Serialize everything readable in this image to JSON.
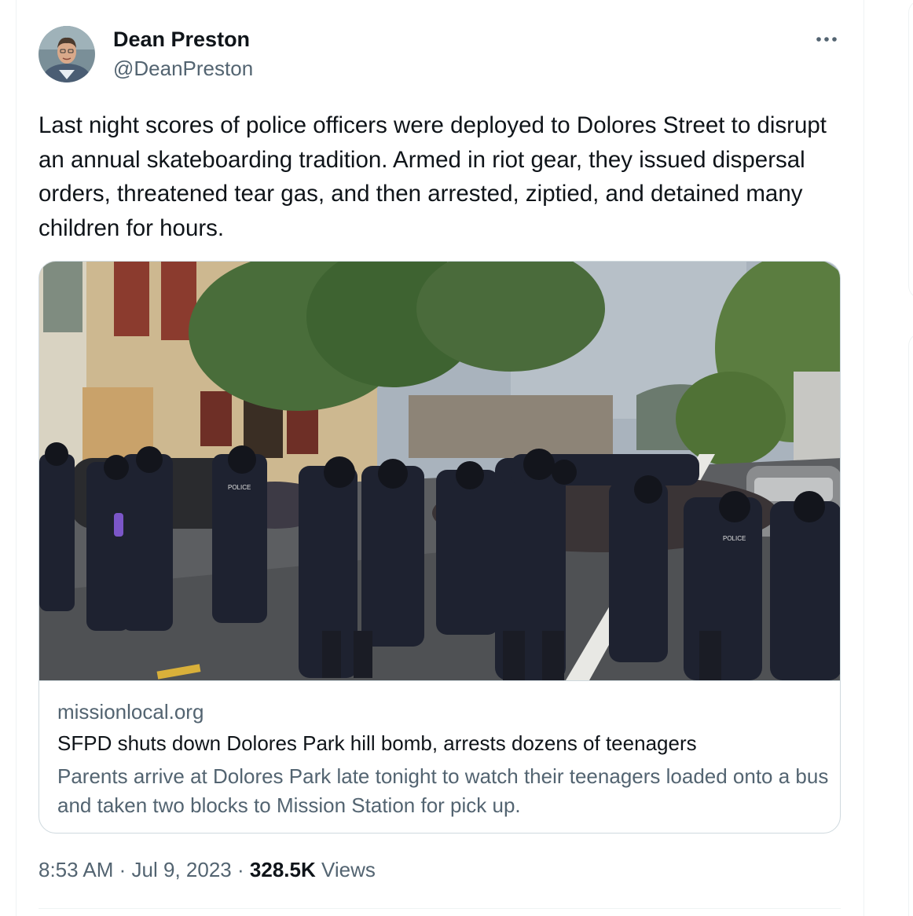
{
  "author": {
    "name": "Dean Preston",
    "handle": "@DeanPreston"
  },
  "tweet": {
    "text": "Last night scores of police officers were deployed to Dolores Street to disrupt an annual skateboarding tradition. Armed in riot gear, they issued dispersal orders, threatened tear gas, and then arrested, ziptied, and detained many children for hours."
  },
  "link_card": {
    "domain": "missionlocal.org",
    "title": "SFPD shuts down Dolores Park hill bomb, arrests dozens of teenagers",
    "description": "Parents arrive at Dolores Park late tonight to watch their teenagers loaded onto a bus and taken two blocks to Mission Station for pick up.",
    "image_text": {
      "police_badge": "POLICE"
    }
  },
  "meta": {
    "time": "8:53 AM",
    "separator": "·",
    "date": "Jul 9, 2023",
    "views_count": "328.5K",
    "views_label": "Views"
  },
  "icons": {
    "more": "more-horizontal-icon"
  },
  "colors": {
    "text_primary": "#0f1419",
    "text_secondary": "#536471",
    "border": "#cfd9de"
  }
}
